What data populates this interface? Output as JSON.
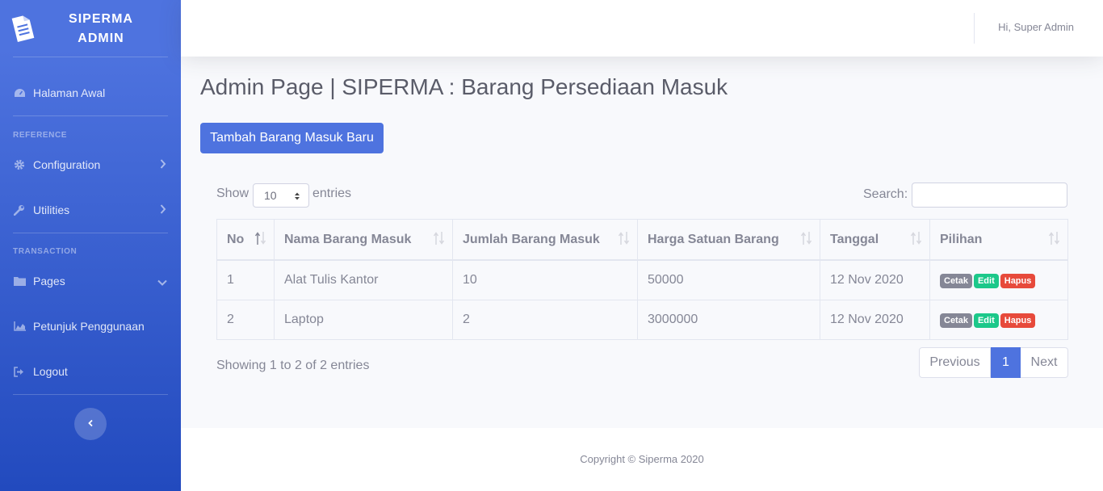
{
  "brand": {
    "line1": "SIPERMA",
    "line2": "ADMIN"
  },
  "sidebar": {
    "home": "Halaman Awal",
    "heading_reference": "REFERENCE",
    "configuration": "Configuration",
    "utilities": "Utilities",
    "heading_transaction": "TRANSACTION",
    "pages": "Pages",
    "guide": "Petunjuk Penggunaan",
    "logout": "Logout"
  },
  "topbar": {
    "user_greeting": "Hi, Super Admin"
  },
  "page": {
    "title": "Admin Page | SIPERMA : Barang Persediaan Masuk",
    "add_button": "Tambah Barang Masuk Baru"
  },
  "datatable": {
    "show_label": "Show",
    "entries_label": "entries",
    "length_value": "10",
    "search_label": "Search:",
    "search_value": "",
    "columns": [
      "No",
      "Nama Barang Masuk",
      "Jumlah Barang Masuk",
      "Harga Satuan Barang",
      "Tanggal",
      "Pilihan"
    ],
    "rows": [
      {
        "no": "1",
        "nama": "Alat Tulis Kantor",
        "jumlah": "10",
        "harga": "50000",
        "tanggal": "12 Nov 2020"
      },
      {
        "no": "2",
        "nama": "Laptop",
        "jumlah": "2",
        "harga": "3000000",
        "tanggal": "12 Nov 2020"
      }
    ],
    "actions": {
      "print": "Cetak",
      "edit": "Edit",
      "delete": "Hapus"
    },
    "info": "Showing 1 to 2 of 2 entries",
    "pagination": {
      "previous": "Previous",
      "current": "1",
      "next": "Next"
    }
  },
  "footer": {
    "copyright": "Copyright © Siperma 2020"
  },
  "colors": {
    "primary": "#4e73df",
    "success": "#1cc88a",
    "danger": "#e74a3b",
    "secondary": "#858796"
  }
}
